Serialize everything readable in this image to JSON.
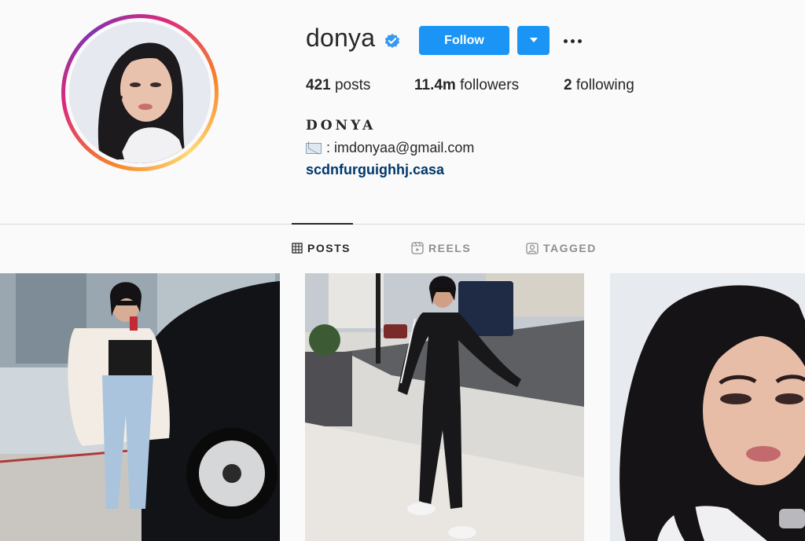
{
  "profile": {
    "username": "donya",
    "verified": true,
    "follow_label": "Follow",
    "dropdown_icon": "caret-down-icon",
    "more_icon": "more-options-icon",
    "full_name": "DONYA",
    "bio_email_prefix": ": imdonyaa@gmail.com",
    "bio_email_icon": "envelope-icon",
    "link": "scdnfurguighhj.casa"
  },
  "stats": {
    "posts_count": "421",
    "posts_label": " posts",
    "followers_count": "11.4m",
    "followers_label": " followers",
    "following_count": "2",
    "following_label": " following"
  },
  "tabs": [
    {
      "label": "POSTS",
      "icon": "grid-icon",
      "active": true
    },
    {
      "label": "REELS",
      "icon": "reels-icon",
      "active": false
    },
    {
      "label": "TAGGED",
      "icon": "tagged-icon",
      "active": false
    }
  ],
  "colors": {
    "accent": "#1a95f6",
    "link": "#00376b",
    "text": "#262626",
    "muted": "#8e8e8e",
    "background": "#fafafa"
  }
}
